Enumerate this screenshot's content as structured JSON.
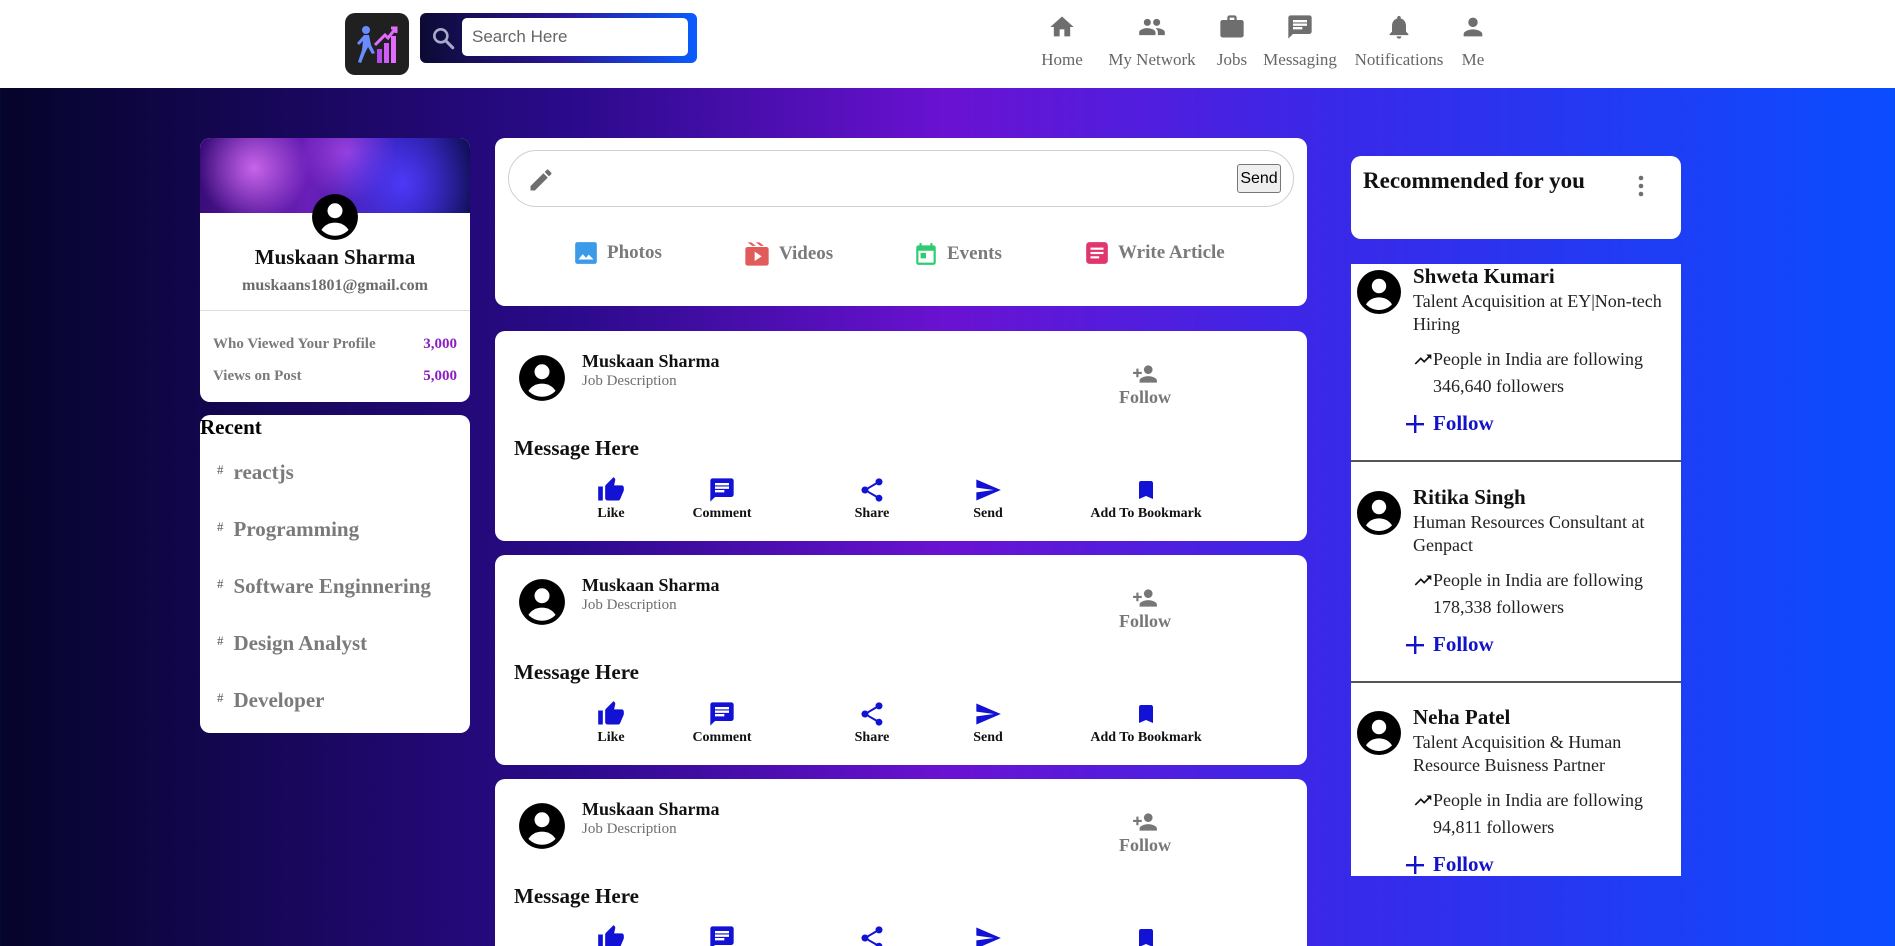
{
  "nav": {
    "search_placeholder": "Search Here",
    "items": [
      {
        "label": "Home",
        "icon": "home-icon"
      },
      {
        "label": "My Network",
        "icon": "network-icon"
      },
      {
        "label": "Jobs",
        "icon": "briefcase-icon"
      },
      {
        "label": "Messaging",
        "icon": "message-icon"
      },
      {
        "label": "Notifications",
        "icon": "bell-icon"
      },
      {
        "label": "Me",
        "icon": "person-icon"
      }
    ]
  },
  "profile": {
    "name": "Muskaan Sharma",
    "email": "muskaans1801@gmail.com",
    "stats": [
      {
        "label": "Who Viewed Your Profile",
        "value": "3,000"
      },
      {
        "label": "Views on Post",
        "value": "5,000"
      }
    ]
  },
  "recent": {
    "title": "Recent",
    "items": [
      "reactjs",
      "Programming",
      "Software Enginnering",
      "Design Analyst",
      "Developer"
    ]
  },
  "composer": {
    "send_label": "Send",
    "actions": [
      {
        "label": "Photos",
        "icon": "photo-icon",
        "color": "#3b9be8"
      },
      {
        "label": "Videos",
        "icon": "video-icon",
        "color": "#e25b5b"
      },
      {
        "label": "Events",
        "icon": "calendar-icon",
        "color": "#2ecc71"
      },
      {
        "label": "Write Article",
        "icon": "article-icon",
        "color": "#e0366d"
      }
    ]
  },
  "posts": [
    {
      "name": "Muskaan Sharma",
      "description": "Job Description",
      "follow_label": "Follow",
      "message": "Message Here"
    },
    {
      "name": "Muskaan Sharma",
      "description": "Job Description",
      "follow_label": "Follow",
      "message": "Message Here"
    },
    {
      "name": "Muskaan Sharma",
      "description": "Job Description",
      "follow_label": "Follow",
      "message": "Message Here"
    }
  ],
  "post_actions": [
    {
      "label": "Like",
      "icon": "thumbs-up-icon"
    },
    {
      "label": "Comment",
      "icon": "comment-icon"
    },
    {
      "label": "Share",
      "icon": "share-icon"
    },
    {
      "label": "Send",
      "icon": "send-icon"
    },
    {
      "label": "Add To Bookmark",
      "icon": "bookmark-icon"
    }
  ],
  "recommended": {
    "title": "Recommended for you",
    "people": [
      {
        "name": "Shweta Kumari",
        "title": "Talent Acquisition at EY|Non-tech Hiring",
        "trend": "People in India are following 346,640 followers",
        "follow_label": "Follow"
      },
      {
        "name": "Ritika Singh",
        "title": "Human Resources Consultant at Genpact",
        "trend": "People in India are following 178,338 followers",
        "follow_label": "Follow"
      },
      {
        "name": "Neha Patel",
        "title": "Talent Acquisition & Human Resource Buisness Partner",
        "trend": "People in India are following 94,811 followers",
        "follow_label": "Follow"
      }
    ]
  },
  "colors": {
    "accent_purple": "#8a1ec0",
    "follow_blue": "#1212c8",
    "action_blue": "#1212d6"
  }
}
